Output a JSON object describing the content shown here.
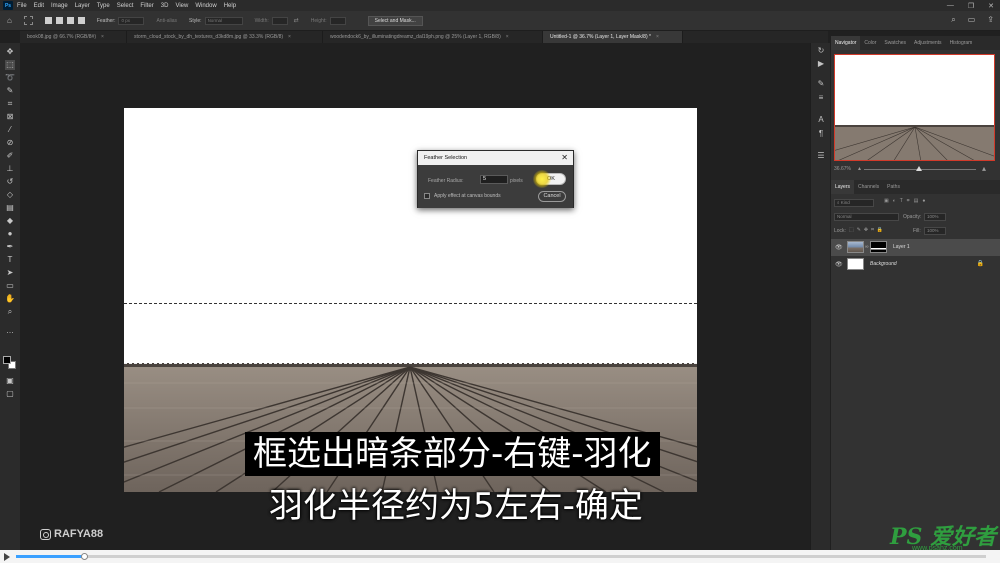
{
  "app": {
    "logo": "Ps"
  },
  "menu": [
    "File",
    "Edit",
    "Image",
    "Layer",
    "Type",
    "Select",
    "Filter",
    "3D",
    "View",
    "Window",
    "Help"
  ],
  "options": {
    "feather_label": "Feather:",
    "feather_value": "0 px",
    "antialias_label": "Anti-alias",
    "style_label": "Style:",
    "style_value": "Normal",
    "width_label": "Width:",
    "height_label": "Height:",
    "select_mask_label": "Select and Mask..."
  },
  "tabs": [
    {
      "label": "book08.jpg @ 66.7% (RGB/8#)",
      "close": "×"
    },
    {
      "label": "storm_cloud_stock_by_dh_textures_d3kd8m.jpg @ 33.3% (RGB/8)",
      "close": "×"
    },
    {
      "label": "woodendock6_by_illuminatingdreamz_dal19ph.png @ 25% (Layer 1, RGB/8)",
      "close": "×"
    },
    {
      "label": "Untitled-1 @ 36.7% (Layer 1, Layer Mask/8) *",
      "close": "×"
    }
  ],
  "dialog": {
    "title": "Feather Selection",
    "close": "✕",
    "radius_label": "Feather Radius:",
    "radius_value": "5",
    "unit": "pixels",
    "checkbox_label": "Apply effect at canvas bounds",
    "ok_label": "OK",
    "cancel_label": "Cancel"
  },
  "panels": {
    "top_tabs": [
      "Navigator",
      "Color",
      "Swatches",
      "Adjustments",
      "Histogram"
    ],
    "zoom": "36.67%",
    "layer_tabs": [
      "Layers",
      "Channels",
      "Paths"
    ],
    "kind_label": "Kind",
    "blend_mode": "Normal",
    "opacity_label": "Opacity:",
    "opacity_value": "100%",
    "lock_label": "Lock:",
    "fill_label": "Fill:",
    "fill_value": "100%",
    "layers": [
      {
        "name": "Layer 1"
      },
      {
        "name": "Background"
      }
    ]
  },
  "subtitles": {
    "line1": "框选出暗条部分-右键-羽化",
    "line2": "羽化半径约为5左右-确定"
  },
  "watermark": "RAFYA88",
  "brand": {
    "logo": "PS 爱好者",
    "url": "www.psahz.com"
  },
  "player": {
    "progress_fraction": 0.07
  },
  "colors": {
    "accent": "#31a8ff",
    "ok_highlight": "#f0dc20",
    "selection_border": "#d23a2a",
    "brand_green": "#2f9e3f"
  }
}
